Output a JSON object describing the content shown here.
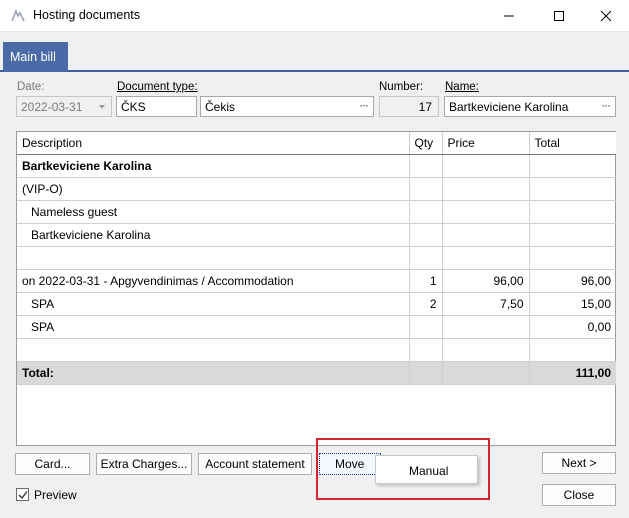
{
  "window": {
    "title": "Hosting documents",
    "minimize_glyph": "—",
    "maximize_glyph": "□",
    "close_glyph": "✕"
  },
  "tabs": [
    {
      "label": "Main bill",
      "active": true
    }
  ],
  "form": {
    "date_label": "Date:",
    "date_value": "2022-03-31",
    "doc_type_label": "Document type:",
    "doc_type_code": "ČKS",
    "doc_type_name": "Čekis",
    "number_label": "Number:",
    "number_value": "17",
    "name_label": "Name:",
    "name_value": "Bartkeviciene Karolina",
    "lookup_glyph": "···"
  },
  "table": {
    "columns": [
      "Description",
      "Qty",
      "Price",
      "Total"
    ],
    "rows": [
      {
        "description": "Bartkeviciene Karolina",
        "qty": "",
        "price": "",
        "total": "",
        "bold": true,
        "indent": false
      },
      {
        "description": "(VIP-O)",
        "qty": "",
        "price": "",
        "total": "",
        "bold": false,
        "indent": false
      },
      {
        "description": "Nameless guest",
        "qty": "",
        "price": "",
        "total": "",
        "bold": false,
        "indent": true
      },
      {
        "description": "Bartkeviciene Karolina",
        "qty": "",
        "price": "",
        "total": "",
        "bold": false,
        "indent": true
      },
      {
        "description": "",
        "qty": "",
        "price": "",
        "total": "",
        "bold": false,
        "indent": false
      },
      {
        "description": "on 2022-03-31 - Apgyvendinimas / Accommodation",
        "qty": "1",
        "price": "96,00",
        "total": "96,00",
        "bold": false,
        "indent": false
      },
      {
        "description": "SPA",
        "qty": "2",
        "price": "7,50",
        "total": "15,00",
        "bold": false,
        "indent": true
      },
      {
        "description": "SPA",
        "qty": "",
        "price": "",
        "total": "0,00",
        "bold": false,
        "indent": true
      },
      {
        "description": "",
        "qty": "",
        "price": "",
        "total": "",
        "bold": false,
        "indent": false
      }
    ],
    "total_row": {
      "label": "Total:",
      "value": "111,00"
    }
  },
  "buttons": {
    "card": "Card...",
    "extra_charges": "Extra Charges...",
    "account_statement": "Account statement",
    "move": "Move",
    "next": "Next >",
    "close": "Close"
  },
  "preview": {
    "label": "Preview",
    "checked": true
  },
  "move_menu": {
    "items": [
      "Manual"
    ]
  },
  "colors": {
    "tab_active": "#4a6aa8",
    "highlight": "#d3262c"
  }
}
